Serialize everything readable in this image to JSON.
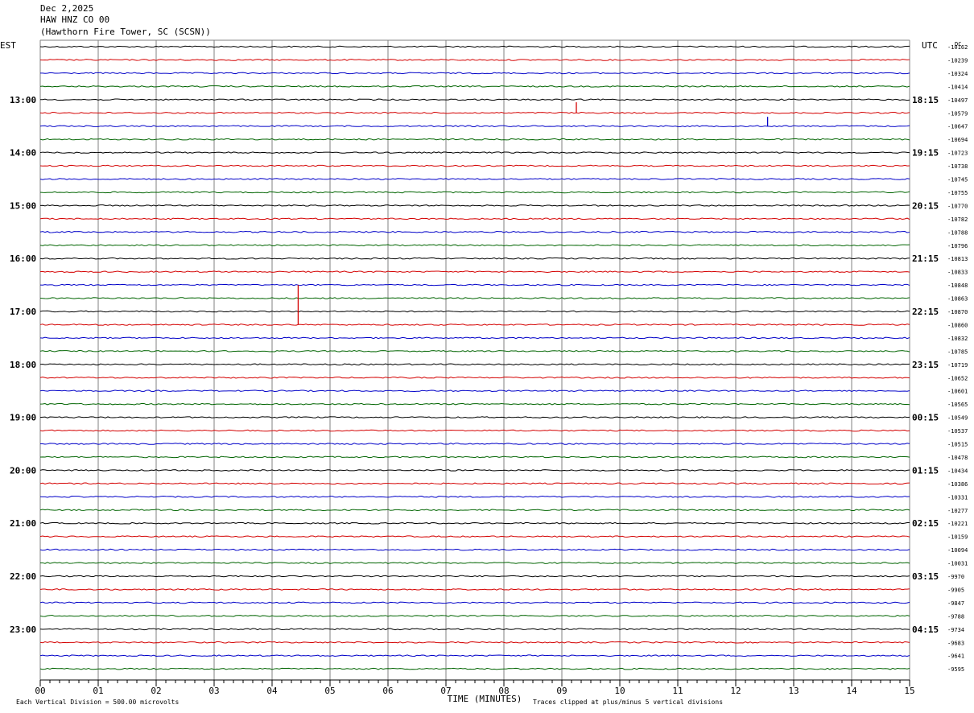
{
  "header": {
    "date": "Dec 2,2025",
    "station": "HAW HNZ CO 00",
    "location": "(Hawthorn Fire Tower, SC (SCSN))"
  },
  "left_zone_label": "EST",
  "right_zone_label": "UTC",
  "dc_label": "DC",
  "footer": {
    "xlabel": "TIME (MINUTES)",
    "scale_note": "Each Vertical Division =  500.00 microvolts",
    "clip_note": "Traces clipped at plus/minus 5 vertical divisions"
  },
  "colors": {
    "trace_cycle": [
      "#000000",
      "#d40000",
      "#0000c8",
      "#006400"
    ],
    "grid": "#808080"
  },
  "chart_data": {
    "type": "line",
    "title": "",
    "xlabel": "TIME (MINUTES)",
    "xlim": [
      0,
      15
    ],
    "x_ticks": [
      "00",
      "01",
      "02",
      "03",
      "04",
      "05",
      "06",
      "07",
      "08",
      "09",
      "10",
      "11",
      "12",
      "13",
      "14",
      "15"
    ],
    "grid": true,
    "trace_interval_minutes": 15,
    "left_hour_labels": [
      "13:00",
      "14:00",
      "15:00",
      "16:00",
      "17:00",
      "18:00",
      "19:00",
      "20:00",
      "21:00",
      "22:00",
      "23:00"
    ],
    "right_hour_labels": [
      "18:15",
      "19:15",
      "20:15",
      "21:15",
      "22:15",
      "23:15",
      "00:15",
      "01:15",
      "02:15",
      "03:15",
      "04:15"
    ],
    "dc_offsets": [
      "-10162",
      "-10239",
      "-10324",
      "-10414",
      "-10497",
      "-10579",
      "-10647",
      "-10694",
      "-10723",
      "-10738",
      "-10745",
      "-10755",
      "-10770",
      "-10782",
      "-10788",
      "-10796",
      "-10813",
      "-10833",
      "-10848",
      "-10863",
      "-10870",
      "-10860",
      "-10832",
      "-10785",
      "-10719",
      "-10652",
      "-10601",
      "-10565",
      "-10549",
      "-10537",
      "-10515",
      "-10478",
      "-10434",
      "-10386",
      "-10331",
      "-10277",
      "-10221",
      "-10159",
      "-10094",
      "-10031",
      "-9970",
      "-9905",
      "-9847",
      "-9788",
      "-9734",
      "-9683",
      "-9641",
      "-9595"
    ],
    "trace_count": 48,
    "events": [
      {
        "trace": 5,
        "minute": 9.25,
        "amplitude": 0.8
      },
      {
        "trace": 6,
        "minute": 12.55,
        "amplitude": 0.7
      },
      {
        "trace": 21,
        "minute": 4.45,
        "amplitude": 3.0
      }
    ]
  }
}
